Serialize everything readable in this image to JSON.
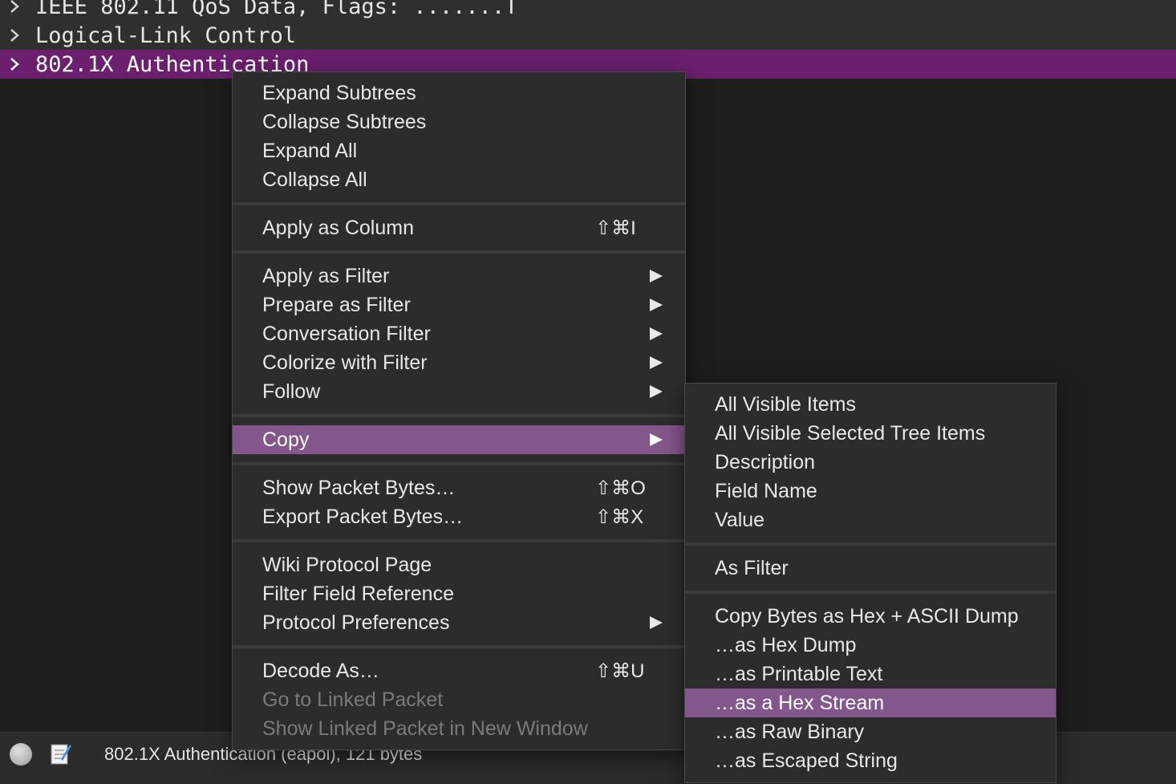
{
  "tree": {
    "rows": [
      {
        "label": "IEEE 802.11 QoS Data, Flags: .......T"
      },
      {
        "label": "Logical-Link Control"
      },
      {
        "label": "802.1X Authentication"
      }
    ]
  },
  "status": {
    "text": "802.1X Authentication (eapol), 121 bytes"
  },
  "context_menu": {
    "items": [
      {
        "label": "Expand Subtrees"
      },
      {
        "label": "Collapse Subtrees"
      },
      {
        "label": "Expand All"
      },
      {
        "label": "Collapse All"
      },
      {
        "label": "Apply as Column",
        "shortcut": "⇧⌘I"
      },
      {
        "label": "Apply as Filter"
      },
      {
        "label": "Prepare as Filter"
      },
      {
        "label": "Conversation Filter"
      },
      {
        "label": "Colorize with Filter"
      },
      {
        "label": "Follow"
      },
      {
        "label": "Copy"
      },
      {
        "label": "Show Packet Bytes…",
        "shortcut": "⇧⌘O"
      },
      {
        "label": "Export Packet Bytes…",
        "shortcut": "⇧⌘X"
      },
      {
        "label": "Wiki Protocol Page"
      },
      {
        "label": "Filter Field Reference"
      },
      {
        "label": "Protocol Preferences"
      },
      {
        "label": "Decode As…",
        "shortcut": "⇧⌘U"
      },
      {
        "label": "Go to Linked Packet"
      },
      {
        "label": "Show Linked Packet in New Window"
      }
    ]
  },
  "copy_submenu": {
    "items": [
      {
        "label": "All Visible Items"
      },
      {
        "label": "All Visible Selected Tree Items"
      },
      {
        "label": "Description"
      },
      {
        "label": "Field Name"
      },
      {
        "label": "Value"
      },
      {
        "label": "As Filter"
      },
      {
        "label": "Copy Bytes as Hex + ASCII Dump"
      },
      {
        "label": "…as Hex Dump"
      },
      {
        "label": "…as Printable Text"
      },
      {
        "label": "…as a Hex Stream"
      },
      {
        "label": "…as Raw Binary"
      },
      {
        "label": "…as Escaped String"
      }
    ]
  },
  "colors": {
    "selected_row": "#6b1f6e",
    "menu_highlight": "#83578b",
    "menu_background": "#2c2c2c"
  }
}
